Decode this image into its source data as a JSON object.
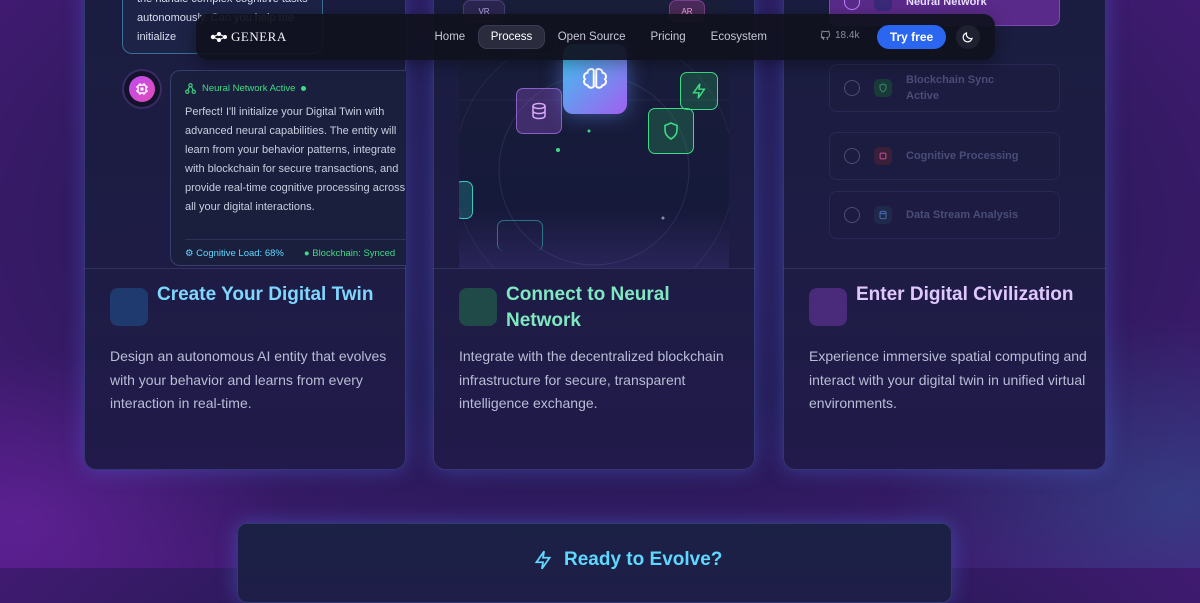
{
  "nav": {
    "brand": "GENERA",
    "links": [
      {
        "label": "Home"
      },
      {
        "label": "Process",
        "active": true
      },
      {
        "label": "Open Source"
      },
      {
        "label": "Pricing"
      },
      {
        "label": "Ecosystem"
      }
    ],
    "stars": "18.4k",
    "cta": "Try free",
    "theme_icon": "moon-icon"
  },
  "cards": [
    {
      "title": "Create Your Digital Twin",
      "description": "Design an autonomous AI entity that evolves with your behavior and learns from every interaction in real-time.",
      "accent": "#1e3a6e",
      "chat": {
        "top_message": "the handle complex cognitive tasks autonomously. Can you help me initialize",
        "status": "Neural Network Active",
        "message": "Perfect! I'll initialize your Digital Twin with advanced neural capabilities. The entity will learn from your behavior patterns, integrate with blockchain for secure transactions, and provide real-time cognitive processing across all your digital interactions.",
        "footer_load": "Cognitive Load: 68%",
        "footer_chain": "Blockchain: Synced"
      }
    },
    {
      "title": "Connect to Neural Network",
      "description": "Integrate with the decentralized blockchain infrastructure for secure, transparent intelligence exchange.",
      "accent": "#1f4a48",
      "nodes": {
        "vr": "VR",
        "ar": "AR"
      }
    },
    {
      "title": "Enter Digital Civilization",
      "description": "Experience immersive spatial computing and interact with your digital twin in unified virtual environments.",
      "accent": "#4a2a7a",
      "tasks": [
        {
          "label": "Neural Network",
          "icon": "brain-icon"
        },
        {
          "label": "Blockchain Sync Active",
          "icon": "shield-icon"
        },
        {
          "label": "Cognitive Processing",
          "icon": "chip-icon"
        },
        {
          "label": "Data Stream Analysis",
          "icon": "database-icon"
        }
      ]
    }
  ],
  "cta": {
    "title": "Ready to Evolve?",
    "icon": "lightning-icon"
  },
  "colors": {
    "brand_blue": "#2a66f0",
    "cyan": "#5fd8ff",
    "green": "#3ddc84"
  }
}
